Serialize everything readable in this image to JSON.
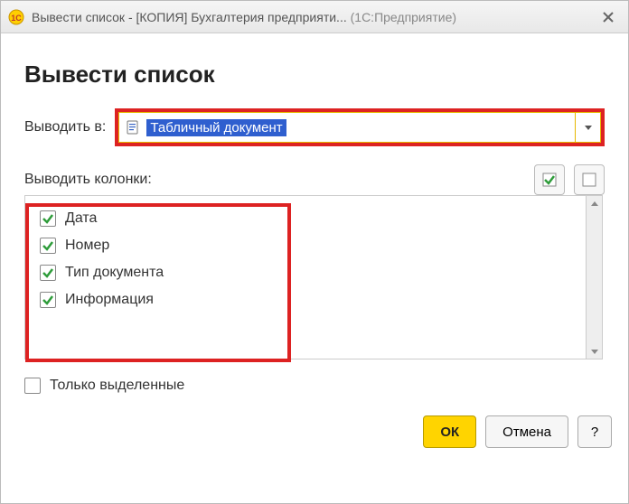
{
  "title": {
    "main": "Вывести список - [КОПИЯ] Бухгалтерия предприяти...",
    "suffix": "(1С:Предприятие)"
  },
  "heading": "Вывести список",
  "output_to": {
    "label": "Выводить в:",
    "value": "Табличный документ"
  },
  "columns": {
    "label": "Выводить колонки:",
    "items": [
      {
        "label": "Дата",
        "checked": true
      },
      {
        "label": "Номер",
        "checked": true
      },
      {
        "label": "Тип документа",
        "checked": true
      },
      {
        "label": "Информация",
        "checked": true
      }
    ]
  },
  "only_selected": {
    "label": "Только выделенные",
    "checked": false
  },
  "buttons": {
    "ok": "ОК",
    "cancel": "Отмена",
    "help": "?"
  }
}
